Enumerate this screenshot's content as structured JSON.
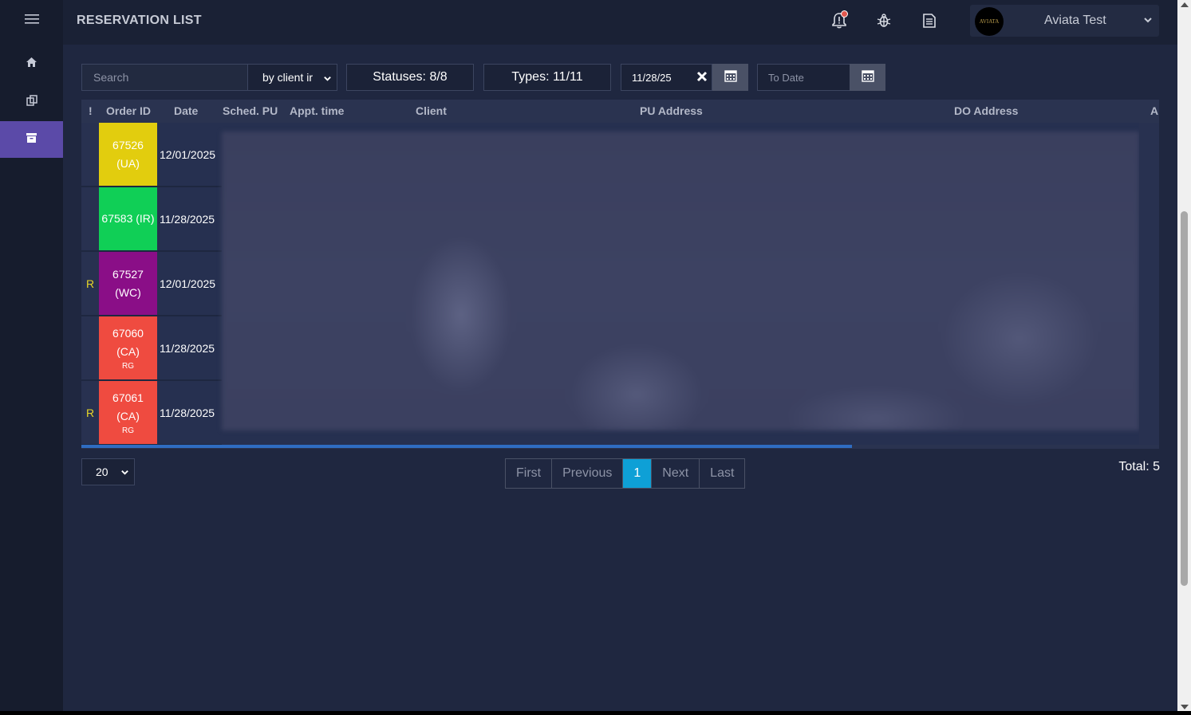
{
  "header": {
    "title": "RESERVATION LIST",
    "user_name": "Aviata Test",
    "avatar_text": "AVIATA",
    "icons": [
      "bell-icon",
      "bug-icon",
      "document-icon"
    ]
  },
  "sidebar": {
    "items": [
      {
        "icon": "menu-icon"
      },
      {
        "icon": "home-icon"
      },
      {
        "icon": "copy-icon"
      },
      {
        "icon": "archive-icon",
        "active": true
      }
    ]
  },
  "filters": {
    "search_placeholder": "Search",
    "search_by": "by client ir",
    "statuses": "Statuses: 8/8",
    "types": "Types: 11/11",
    "from_date": "11/28/25",
    "to_date_placeholder": "To Date"
  },
  "table": {
    "columns": [
      "!",
      "Order ID",
      "Date",
      "Sched. PU",
      "Appt. time",
      "Client",
      "PU Address",
      "DO Address",
      "A"
    ],
    "rows": [
      {
        "flag": "",
        "order": "67526",
        "code": "(UA)",
        "sub": "",
        "date": "12/01/2025",
        "color": "#e2cd0e"
      },
      {
        "flag": "",
        "order": "67583 (IR)",
        "code": "",
        "sub": "",
        "date": "11/28/2025",
        "color": "#10cf56"
      },
      {
        "flag": "R",
        "order": "67527",
        "code": "(WC)",
        "sub": "",
        "date": "12/01/2025",
        "color": "#8a0e87"
      },
      {
        "flag": "",
        "order": "67060",
        "code": "(CA)",
        "sub": "RG",
        "date": "11/28/2025",
        "color": "#ef4b40"
      },
      {
        "flag": "R",
        "order": "67061",
        "code": "(CA)",
        "sub": "RG",
        "date": "11/28/2025",
        "color": "#ef4b40"
      }
    ]
  },
  "pagination": {
    "page_size": "20",
    "buttons": [
      "First",
      "Previous",
      "1",
      "Next",
      "Last"
    ],
    "active": "1",
    "total": "Total: 5"
  }
}
